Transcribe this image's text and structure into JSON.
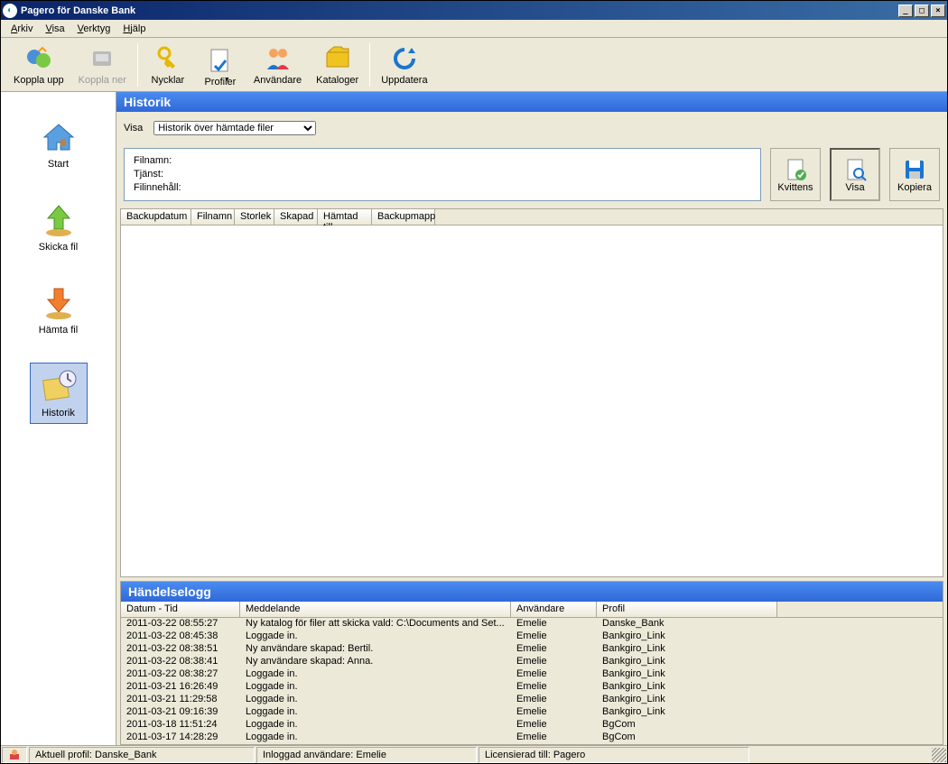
{
  "window": {
    "title": "Pagero för Danske Bank"
  },
  "menu": {
    "arkiv": "Arkiv",
    "visa": "Visa",
    "verktyg": "Verktyg",
    "hjalp": "Hjälp"
  },
  "toolbar": {
    "koppla_upp": "Koppla upp",
    "koppla_ner": "Koppla ner",
    "nycklar": "Nycklar",
    "profiler": "Profiler",
    "anvandare": "Användare",
    "kataloger": "Kataloger",
    "uppdatera": "Uppdatera"
  },
  "sidebar": {
    "start": "Start",
    "skicka": "Skicka fil",
    "hamta": "Hämta fil",
    "historik": "Historik"
  },
  "historik": {
    "title": "Historik",
    "visa_label": "Visa",
    "visa_value": "Historik över hämtade filer",
    "filnamn": "Filnamn:",
    "tjanst": "Tjänst:",
    "filinnehall": "Filinnehåll:",
    "kvittens": "Kvittens",
    "visa_btn": "Visa",
    "kopiera": "Kopiera",
    "cols": {
      "backupdatum": "Backupdatum",
      "filnamn": "Filnamn",
      "storlek": "Storlek",
      "skapad": "Skapad",
      "hamtad_till": "Hämtad till",
      "backupmapp": "Backupmapp"
    }
  },
  "eventlog": {
    "title": "Händelselogg",
    "cols": {
      "datum": "Datum - Tid",
      "meddelande": "Meddelande",
      "anvandare": "Användare",
      "profil": "Profil"
    },
    "rows": [
      {
        "d": "2011-03-22 08:55:27",
        "m": "Ny katalog för filer att skicka vald: C:\\Documents and Set...",
        "u": "Emelie",
        "p": "Danske_Bank"
      },
      {
        "d": "2011-03-22 08:45:38",
        "m": "Loggade in.",
        "u": "Emelie",
        "p": "Bankgiro_Link"
      },
      {
        "d": "2011-03-22 08:38:51",
        "m": "Ny användare skapad: Bertil.",
        "u": "Emelie",
        "p": "Bankgiro_Link"
      },
      {
        "d": "2011-03-22 08:38:41",
        "m": "Ny användare skapad: Anna.",
        "u": "Emelie",
        "p": "Bankgiro_Link"
      },
      {
        "d": "2011-03-22 08:38:27",
        "m": "Loggade in.",
        "u": "Emelie",
        "p": "Bankgiro_Link"
      },
      {
        "d": "2011-03-21 16:26:49",
        "m": "Loggade in.",
        "u": "Emelie",
        "p": "Bankgiro_Link"
      },
      {
        "d": "2011-03-21 11:29:58",
        "m": "Loggade in.",
        "u": "Emelie",
        "p": "Bankgiro_Link"
      },
      {
        "d": "2011-03-21 09:16:39",
        "m": "Loggade in.",
        "u": "Emelie",
        "p": "Bankgiro_Link"
      },
      {
        "d": "2011-03-18 11:51:24",
        "m": "Loggade in.",
        "u": "Emelie",
        "p": "BgCom"
      },
      {
        "d": "2011-03-17 14:28:29",
        "m": "Loggade in.",
        "u": "Emelie",
        "p": "BgCom"
      }
    ]
  },
  "statusbar": {
    "profil": "Aktuell profil: Danske_Bank",
    "user": "Inloggad användare: Emelie",
    "licens": "Licensierad till: Pagero"
  }
}
